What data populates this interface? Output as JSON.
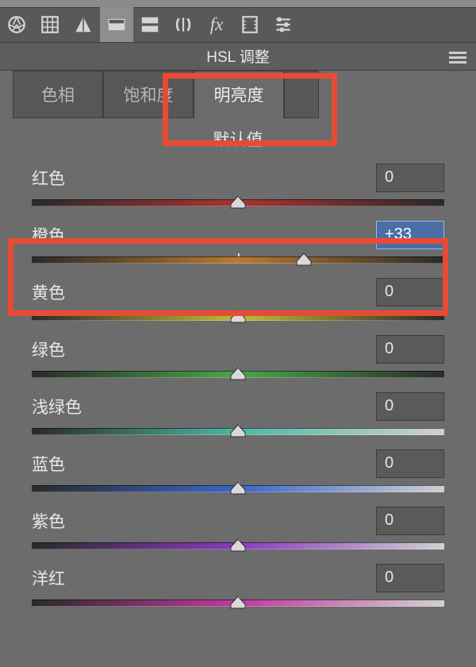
{
  "panel": {
    "title": "HSL 调整",
    "default_label": "默认值"
  },
  "tabs": [
    {
      "label": "色相",
      "active": false
    },
    {
      "label": "饱和度",
      "active": false
    },
    {
      "label": "明亮度",
      "active": true
    }
  ],
  "sliders": [
    {
      "label": "红色",
      "value": "0",
      "pos_pct": 50,
      "gradient": "red",
      "active": false
    },
    {
      "label": "橙色",
      "value": "+33",
      "pos_pct": 66,
      "gradient": "orange",
      "active": true
    },
    {
      "label": "黄色",
      "value": "0",
      "pos_pct": 50,
      "gradient": "yellow",
      "active": false
    },
    {
      "label": "绿色",
      "value": "0",
      "pos_pct": 50,
      "gradient": "green",
      "active": false
    },
    {
      "label": "浅绿色",
      "value": "0",
      "pos_pct": 50,
      "gradient": "aqua",
      "active": false
    },
    {
      "label": "蓝色",
      "value": "0",
      "pos_pct": 50,
      "gradient": "blue",
      "active": false
    },
    {
      "label": "紫色",
      "value": "0",
      "pos_pct": 50,
      "gradient": "purple",
      "active": false
    },
    {
      "label": "洋红",
      "value": "0",
      "pos_pct": 50,
      "gradient": "magenta",
      "active": false
    }
  ],
  "highlights": {
    "tab_box": true,
    "orange_row": true
  }
}
